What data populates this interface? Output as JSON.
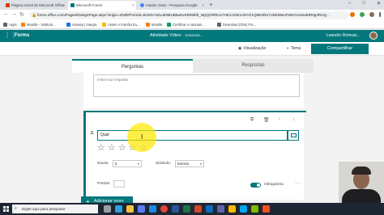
{
  "browser": {
    "tabs": [
      {
        "label": "Página Inicial do Microsoft Office",
        "close": "×",
        "color": "#d83b01",
        "active": false
      },
      {
        "label": "Microsoft Forms",
        "close": "×",
        "color": "#03787c",
        "active": true
      },
      {
        "label": "master class - Pesquisa Google",
        "close": "×",
        "color": "#4285f4",
        "active": false
      }
    ],
    "new_tab": "+",
    "url": "forms.office.com/Pages/DesignPage.aspx?origin=shell#FormId=kt1MV-0vtxJE6BUB8uDvKkRMfdl_NQQGRRUn7HE1UOE1ARAF1Q5E0RUY25EZMUF6WVVwN1BIR0g3RUQ...",
    "bookmarks": [
      {
        "label": "Apps",
        "color": "#5f6368"
      },
      {
        "label": "Moodle - Instituto...",
        "color": "#f98012"
      },
      {
        "label": "Uniwap | Integra",
        "color": "#1a73e8"
      },
      {
        "label": "Assim A Família Eu...",
        "color": "#fbbc04"
      },
      {
        "label": "Moodle",
        "color": "#f98012"
      },
      {
        "label": "Certificar e tutoriais...",
        "color": "#0f9d58"
      },
      {
        "label": "Download (Obs) Fre...",
        "color": "#5f6368"
      }
    ]
  },
  "forms": {
    "brand": "Forms",
    "title": "Atividade Vídeo",
    "saving": "- Salvando...",
    "user": "Leandro Romual...",
    "preview_label": "Visualização",
    "theme_label": "Tema",
    "share_label": "Compartilhar",
    "tabs": {
      "questions": "Perguntas",
      "responses": "Respostas"
    }
  },
  "previous_question": {
    "answer_placeholder": "Insira sua resposta"
  },
  "question": {
    "number": "2.",
    "text": "Qual",
    "stars": [
      "☆",
      "☆",
      "☆",
      "☆",
      "☆"
    ],
    "levels_label": "Níveis:",
    "levels_value": "5",
    "symbol_label": "Símbolo:",
    "symbol_value": "Estrela",
    "points_label": "Pontos:",
    "required_label": "Obrigatória",
    "required": true,
    "more": "···"
  },
  "add_new_label": "Adicionar novo",
  "taskbar": {
    "search_placeholder": "Digite aqui para pesquisar"
  }
}
